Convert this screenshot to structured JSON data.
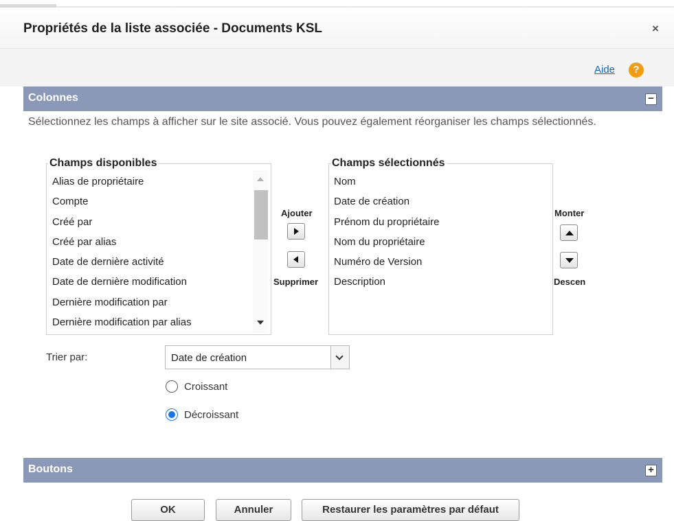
{
  "dialog": {
    "title": "Propriétés de la liste associée - Documents KSL",
    "close_glyph": "×",
    "help_label": "Aide",
    "help_glyph": "?"
  },
  "columns_section": {
    "title": "Colonnes",
    "toggle_glyph": "−",
    "description": "Sélectionnez les champs à afficher sur le site associé. Vous pouvez également réorganiser les champs sélectionnés.",
    "available": {
      "label": "Champs disponibles",
      "items": [
        "Alias de propriétaire",
        "Compte",
        "Créé par",
        "Créé par alias",
        "Date de dernière activité",
        "Date de dernière modification",
        "Dernière modification par",
        "Dernière modification par alias"
      ]
    },
    "selected": {
      "label": "Champs sélectionnés",
      "items": [
        "Nom",
        "Date de création",
        "Prénom du propriétaire",
        "Nom du propriétaire",
        "Numéro de Version",
        "Description"
      ]
    },
    "add_label": "Ajouter",
    "remove_label": "Supprimer",
    "up_label": "Monter",
    "down_label": "Descen"
  },
  "sort": {
    "label": "Trier par:",
    "selected": "Date de création",
    "ascending_label": "Croissant",
    "descending_label": "Décroissant",
    "order": "Décroissant"
  },
  "buttons_section": {
    "title": "Boutons",
    "toggle_glyph": "+"
  },
  "footer": {
    "ok": "OK",
    "cancel": "Annuler",
    "restore": "Restaurer les paramètres par défaut"
  },
  "colors": {
    "section_bar": "#8a99b8",
    "link": "#1565c0",
    "help_icon": "#f39c12",
    "radio_checked": "#1a73e8"
  }
}
